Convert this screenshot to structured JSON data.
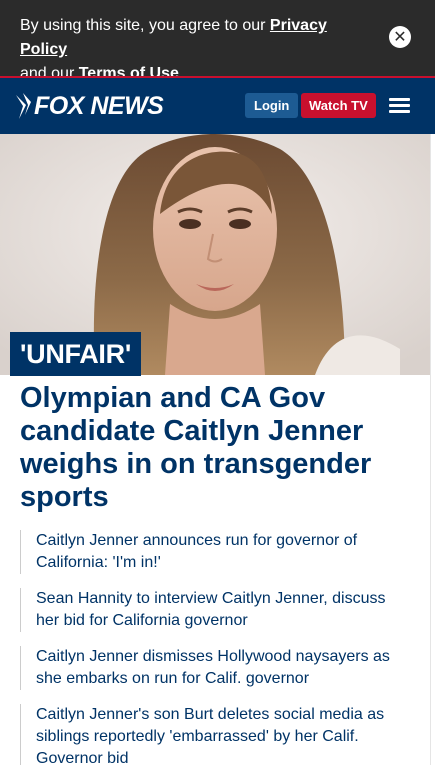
{
  "consent": {
    "text_before": "By using this site, you agree to our ",
    "privacy_link": "Privacy Policy",
    "text_middle": " and our ",
    "terms_link": "Terms of Use",
    "text_after": ".",
    "close_icon": "close-icon"
  },
  "header": {
    "logo_text": "FOX NEWS",
    "login_label": "Login",
    "watch_label": "Watch TV",
    "menu_icon": "hamburger-menu-icon",
    "colors": {
      "navy": "#003366",
      "red": "#c8102e"
    }
  },
  "article": {
    "kicker": "'UNFAIR'",
    "headline": "Olympian and CA Gov candidate Caitlyn Jenner weighs in on transgender sports"
  },
  "related": [
    {
      "title": "Caitlyn Jenner announces run for governor of California: 'I'm in!'"
    },
    {
      "title": "Sean Hannity to interview Caitlyn Jenner, discuss her bid for California governor"
    },
    {
      "title": "Caitlyn Jenner dismisses Hollywood naysayers as she embarks on run for Calif. governor"
    },
    {
      "title": "Caitlyn Jenner's son Burt deletes social media as siblings reportedly 'embarrassed' by her Calif. Governor bid"
    }
  ]
}
